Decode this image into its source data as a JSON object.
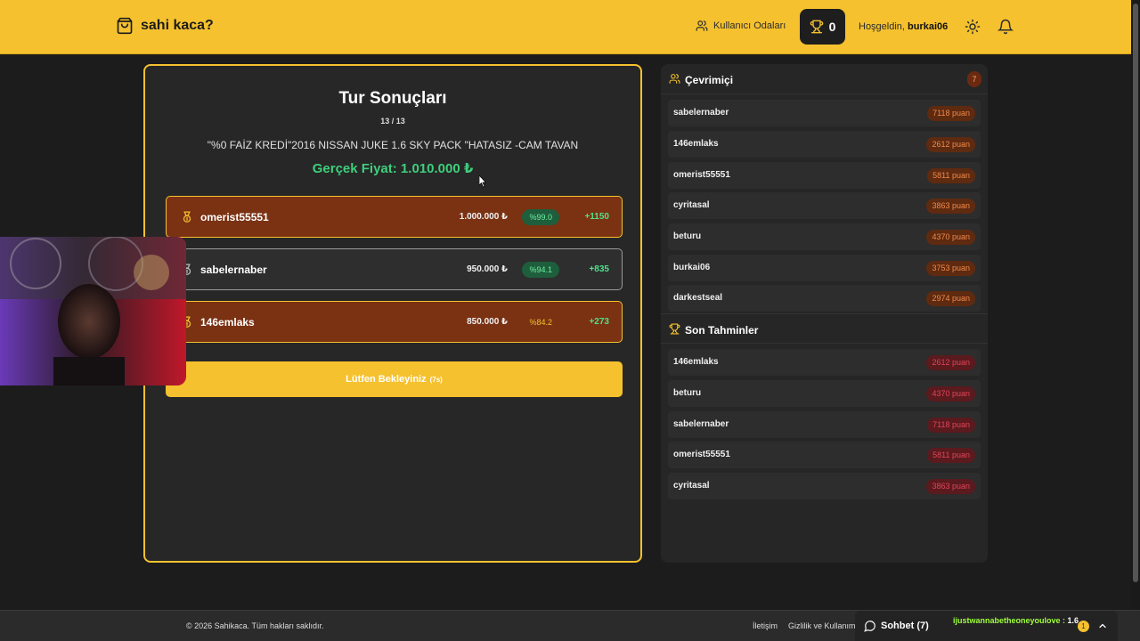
{
  "header": {
    "brand": "sahi kaca?",
    "rooms_label": "Kullanıcı Odaları",
    "trophy_count": "0",
    "welcome_prefix": "Hoşgeldin,",
    "username": "burkai06"
  },
  "round": {
    "title": "Tur Sonuçları",
    "counter": "13 / 13",
    "item_title": "\"%0 FAİZ KREDİ\"2016 NISSAN JUKE 1.6 SKY PACK \"HATASIZ -CAM TAVAN",
    "real_price": "Gerçek Fiyat: 1.010.000 ₺",
    "results": [
      {
        "name": "omerist55551",
        "guess": "1.000.000 ₺",
        "accuracy": "%99.0",
        "points": "+1150"
      },
      {
        "name": "sabelernaber",
        "guess": "950.000 ₺",
        "accuracy": "%94.1",
        "points": "+835"
      },
      {
        "name": "146emlaks",
        "guess": "850.000 ₺",
        "accuracy": "%84.2",
        "points": "+273"
      }
    ],
    "wait_label": "Lütfen Bekleyiniz",
    "wait_seconds": "(7s)"
  },
  "online": {
    "title": "Çevrimiçi",
    "count": "7",
    "players": [
      {
        "name": "sabelernaber",
        "score": "7118 puan"
      },
      {
        "name": "146emlaks",
        "score": "2612 puan"
      },
      {
        "name": "omerist55551",
        "score": "5811 puan"
      },
      {
        "name": "cyritasal",
        "score": "3863 puan"
      },
      {
        "name": "beturu",
        "score": "4370 puan"
      },
      {
        "name": "burkai06",
        "score": "3753 puan"
      },
      {
        "name": "darkestseal",
        "score": "2974 puan"
      }
    ]
  },
  "recent": {
    "title": "Son Tahminler",
    "players": [
      {
        "name": "146emlaks",
        "score": "2612 puan"
      },
      {
        "name": "beturu",
        "score": "4370 puan"
      },
      {
        "name": "sabelernaber",
        "score": "7118 puan"
      },
      {
        "name": "omerist55551",
        "score": "5811 puan"
      },
      {
        "name": "cyritasal",
        "score": "3863 puan"
      }
    ]
  },
  "footer": {
    "copyright": "© 2026 Sahikaca. Tüm hakları saklıdır.",
    "contact": "İletişim",
    "privacy": "Gizlilik ve Kullanım",
    "chat_label": "Sohbet (7)",
    "chat_user": "ijustwannabetheoneyoulove :",
    "chat_text": "1.6",
    "chat_badge": "1"
  },
  "colors": {
    "accent": "#f5c12e",
    "success": "#3ecf7c",
    "gold_row": "#7a3213",
    "panel": "#262626"
  }
}
